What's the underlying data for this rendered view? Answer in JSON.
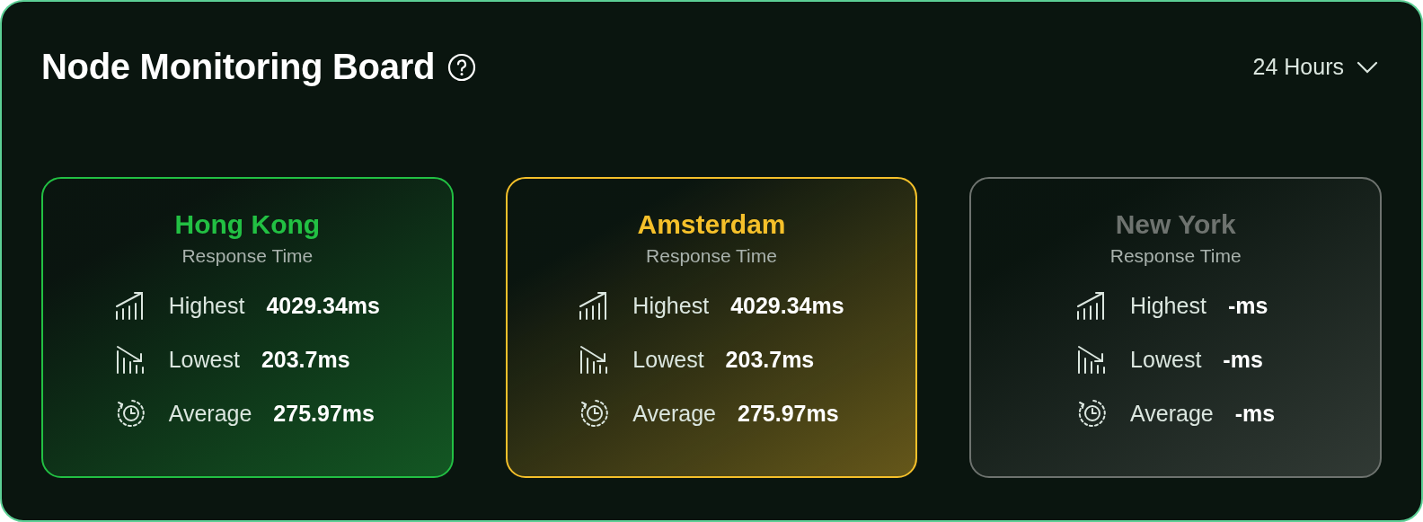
{
  "title": "Node Monitoring Board",
  "range": {
    "label": "24 Hours"
  },
  "nodes": [
    {
      "name": "Hong Kong",
      "subtitle": "Response Time",
      "color": "#22c043",
      "stats": [
        {
          "kind": "highest",
          "label": "Highest",
          "value": "4029.34ms"
        },
        {
          "kind": "lowest",
          "label": "Lowest",
          "value": "203.7ms"
        },
        {
          "kind": "average",
          "label": "Average",
          "value": "275.97ms"
        }
      ]
    },
    {
      "name": "Amsterdam",
      "subtitle": "Response Time",
      "color": "#f5c02a",
      "stats": [
        {
          "kind": "highest",
          "label": "Highest",
          "value": "4029.34ms"
        },
        {
          "kind": "lowest",
          "label": "Lowest",
          "value": "203.7ms"
        },
        {
          "kind": "average",
          "label": "Average",
          "value": "275.97ms"
        }
      ]
    },
    {
      "name": "New York",
      "subtitle": "Response Time",
      "color": "#6e736f",
      "stats": [
        {
          "kind": "highest",
          "label": "Highest",
          "value": "-ms"
        },
        {
          "kind": "lowest",
          "label": "Lowest",
          "value": "-ms"
        },
        {
          "kind": "average",
          "label": "Average",
          "value": "-ms"
        }
      ]
    }
  ]
}
